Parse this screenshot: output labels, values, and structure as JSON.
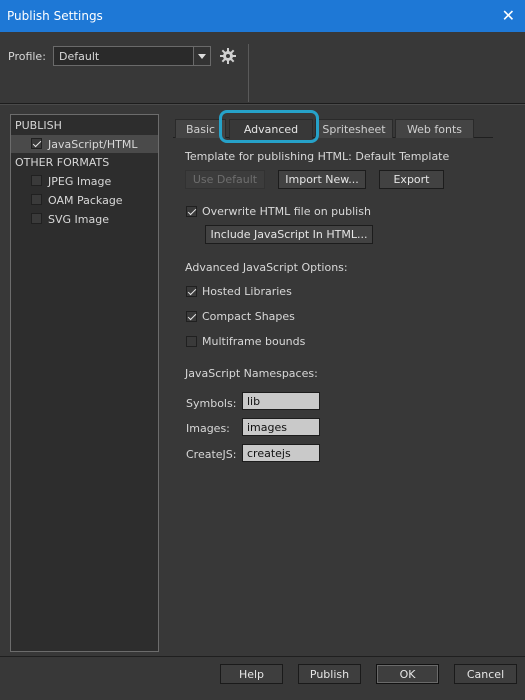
{
  "window": {
    "title": "Publish Settings",
    "close_glyph": "✕"
  },
  "profile": {
    "label": "Profile:",
    "value": "Default"
  },
  "sidebar": {
    "publish_header": "PUBLISH",
    "publish_items": [
      {
        "label": "JavaScript/HTML",
        "checked": true
      }
    ],
    "other_header": "OTHER FORMATS",
    "other_items": [
      {
        "label": "JPEG Image",
        "checked": false
      },
      {
        "label": "OAM Package",
        "checked": false
      },
      {
        "label": "SVG Image",
        "checked": false
      }
    ]
  },
  "tabs": [
    "Basic",
    "Advanced",
    "Spritesheet",
    "Web fonts"
  ],
  "active_tab": "Advanced",
  "advanced": {
    "template_label": "Template for publishing HTML: Default Template",
    "use_default": "Use Default",
    "import_new": "Import New...",
    "export": "Export",
    "overwrite_label": "Overwrite HTML file on publish",
    "overwrite_checked": true,
    "include_js": "Include JavaScript In HTML...",
    "js_options_header": "Advanced JavaScript Options:",
    "hosted_libraries": "Hosted Libraries",
    "compact_shapes": "Compact Shapes",
    "multiframe_bounds": "Multiframe bounds",
    "namespaces_header": "JavaScript Namespaces:",
    "symbols_label": "Symbols:",
    "symbols_value": "lib",
    "images_label": "Images:",
    "images_value": "images",
    "createjs_label": "CreateJS:",
    "createjs_value": "createjs"
  },
  "footer": {
    "help": "Help",
    "publish": "Publish",
    "ok": "OK",
    "cancel": "Cancel"
  },
  "colors": {
    "titlebar": "#1e78d6",
    "highlight": "#26a2c9",
    "background": "#383838"
  }
}
